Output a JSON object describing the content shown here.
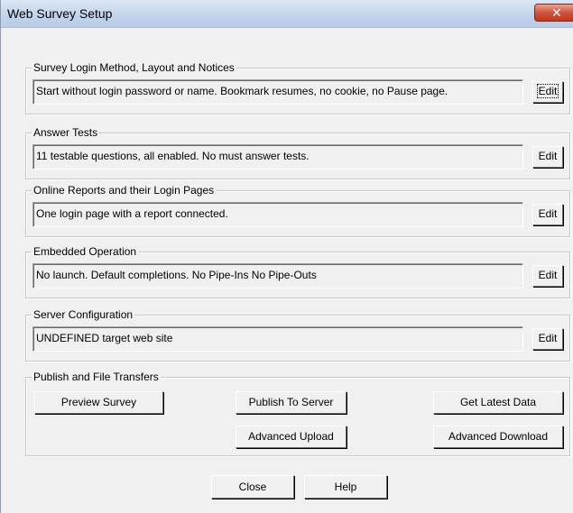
{
  "window": {
    "title": "Web Survey Setup",
    "close_glyph": "✕"
  },
  "groups": [
    {
      "label": "Survey Login Method, Layout and Notices",
      "summary": "Start without login password or name. Bookmark resumes,  no cookie, no Pause page.",
      "button": "Edit"
    },
    {
      "label": "Answer Tests",
      "summary": "11 testable questions, all enabled.  No must answer tests.",
      "button": "Edit"
    },
    {
      "label": "Online Reports and their Login Pages",
      "summary": "One login page with a report connected.",
      "button": "Edit"
    },
    {
      "label": "Embedded Operation",
      "summary": "No launch. Default completions. No Pipe-Ins No Pipe-Outs",
      "button": "Edit"
    },
    {
      "label": "Server Configuration",
      "summary": "UNDEFINED target web site",
      "button": "Edit"
    }
  ],
  "publish": {
    "label": "Publish and File Transfers",
    "preview": "Preview Survey",
    "publish_server": "Publish To Server",
    "get_latest": "Get Latest Data",
    "advanced_upload": "Advanced Upload",
    "advanced_download": "Advanced Download"
  },
  "footer": {
    "close": "Close",
    "help": "Help"
  }
}
